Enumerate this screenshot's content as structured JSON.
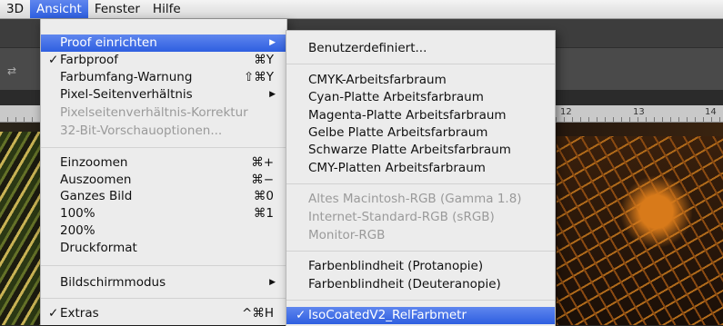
{
  "menubar": {
    "items": [
      {
        "label": "3D"
      },
      {
        "label": "Ansicht"
      },
      {
        "label": "Fenster"
      },
      {
        "label": "Hilfe"
      }
    ]
  },
  "ruler": {
    "ticks": [
      "12",
      "13",
      "14"
    ]
  },
  "ansicht_menu": {
    "items": [
      {
        "label": "Proof einrichten",
        "shortcut": "",
        "submenu": true,
        "checked": false,
        "disabled": false,
        "highlighted": true
      },
      {
        "label": "Farbproof",
        "shortcut": "⌘Y",
        "checked": true
      },
      {
        "label": "Farbumfang-Warnung",
        "shortcut": "⇧⌘Y"
      },
      {
        "label": "Pixel-Seitenverhältnis",
        "shortcut": "",
        "submenu": true
      },
      {
        "label": "Pixelseitenverhältnis-Korrektur",
        "disabled": true
      },
      {
        "label": "32-Bit-Vorschauoptionen...",
        "disabled": true
      },
      {
        "label": "Einzoomen",
        "shortcut": "⌘+"
      },
      {
        "label": "Auszoomen",
        "shortcut": "⌘−"
      },
      {
        "label": "Ganzes Bild",
        "shortcut": "⌘0"
      },
      {
        "label": "100%",
        "shortcut": "⌘1"
      },
      {
        "label": "200%",
        "shortcut": ""
      },
      {
        "label": "Druckformat",
        "shortcut": ""
      },
      {
        "label": "Bildschirmmodus",
        "submenu": true
      },
      {
        "label": "Extras",
        "shortcut": "^⌘H",
        "checked": true
      }
    ]
  },
  "proof_submenu": {
    "items": [
      {
        "label": "Benutzerdefiniert..."
      },
      {
        "label": "CMYK-Arbeitsfarbraum"
      },
      {
        "label": "Cyan-Platte Arbeitsfarbraum"
      },
      {
        "label": "Magenta-Platte Arbeitsfarbraum"
      },
      {
        "label": "Gelbe Platte Arbeitsfarbraum"
      },
      {
        "label": "Schwarze Platte Arbeitsfarbraum"
      },
      {
        "label": "CMY-Platten Arbeitsfarbraum"
      },
      {
        "label": "Altes Macintosh-RGB (Gamma 1.8)",
        "disabled": true
      },
      {
        "label": "Internet-Standard-RGB (sRGB)",
        "disabled": true
      },
      {
        "label": "Monitor-RGB",
        "disabled": true
      },
      {
        "label": "Farbenblindheit (Protanopie)"
      },
      {
        "label": "Farbenblindheit (Deuteranopie)"
      },
      {
        "label": "IsoCoatedV2_RelFarbmetr",
        "checked": true,
        "highlighted": true
      }
    ]
  },
  "glyphs": {
    "check": "✓",
    "arrow": "▶",
    "swap": "⇄"
  },
  "colors": {
    "highlight": "#3d6ee6",
    "menu_bg": "#ececec",
    "disabled": "#9a9a9a"
  }
}
